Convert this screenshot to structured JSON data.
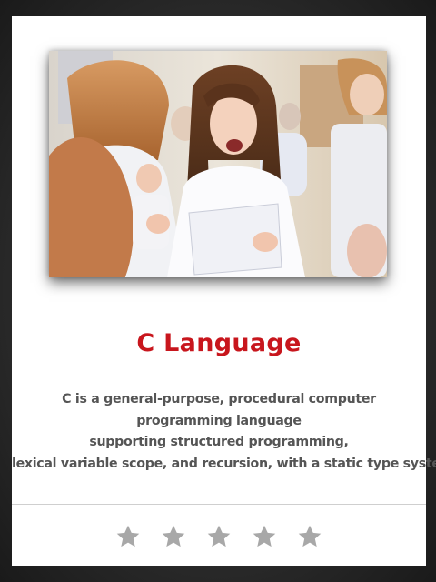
{
  "card": {
    "title": "C Language",
    "description_lines": [
      "C is a general-purpose, procedural computer",
      "programming language",
      "supporting structured programming,",
      "lexical variable scope, and recursion, with a static type system."
    ]
  },
  "rating": {
    "max_stars": 5,
    "filled_stars": 5,
    "star_color": "#a8a8a8"
  },
  "colors": {
    "title": "#c8161d",
    "text": "#555555",
    "background": "#2e2e2e",
    "card": "#ffffff"
  },
  "image": {
    "content": "photo-children-singing"
  }
}
